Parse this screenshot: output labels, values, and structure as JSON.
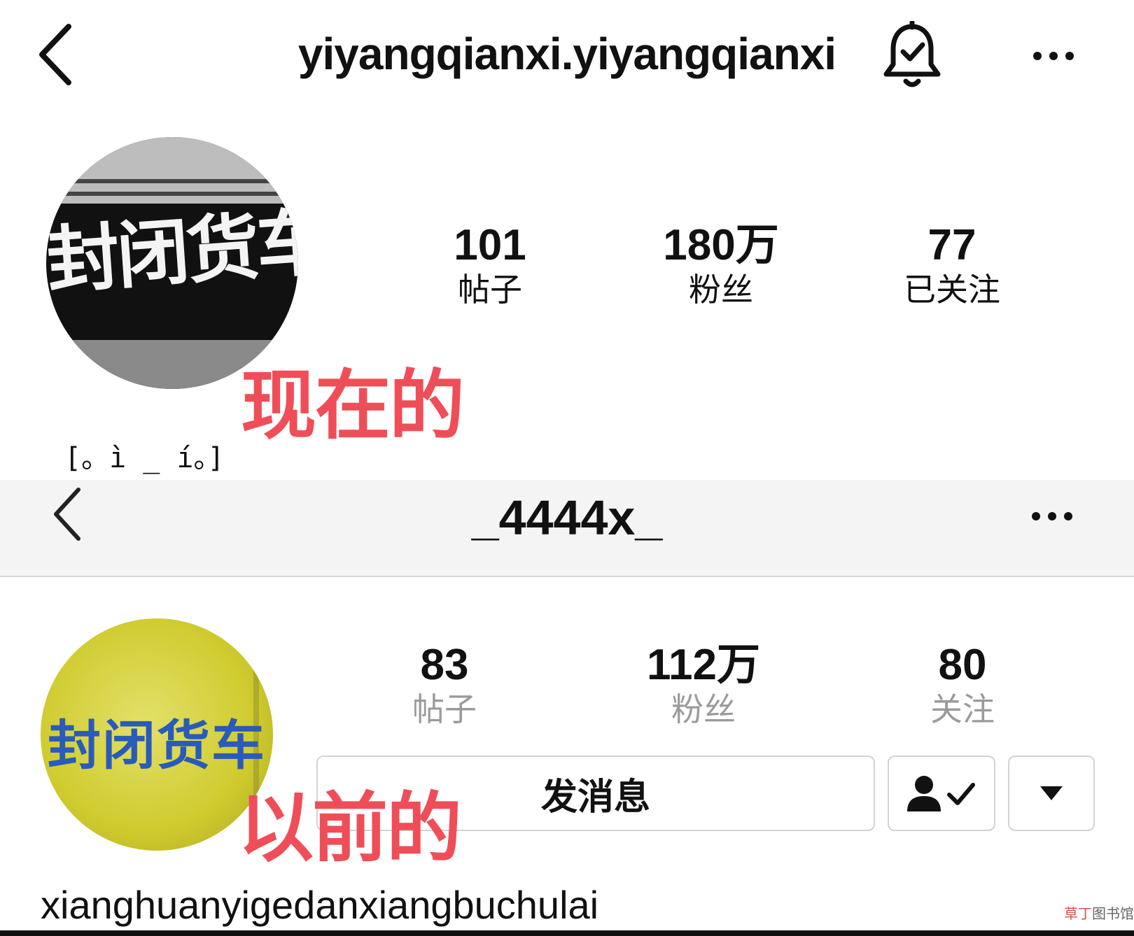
{
  "current": {
    "username": "yiyangqianxi.yiyangqianxi",
    "avatar_text": "封闭货车",
    "stats": [
      {
        "value": "101",
        "label": "帖子"
      },
      {
        "value": "180万",
        "label": "粉丝"
      },
      {
        "value": "77",
        "label": "已关注"
      }
    ],
    "caption": "现在的",
    "bio": "[。ì _ í。]"
  },
  "previous": {
    "username": "_4444x_",
    "avatar_text": "封闭货车",
    "stats": [
      {
        "value": "83",
        "label": "帖子"
      },
      {
        "value": "112万",
        "label": "粉丝"
      },
      {
        "value": "80",
        "label": "关注"
      }
    ],
    "message_button": "发消息",
    "caption": "以前的",
    "bio": "xianghuanyigedanxiangbuchulai"
  },
  "watermark": {
    "accent": "草丁",
    "rest": "图书馆"
  },
  "colors": {
    "caption": "#ef4e58",
    "avatar_previous": "#cfcb2e",
    "sign_blue": "#2a5bb8"
  },
  "icons": {
    "back": "chevron-left-icon",
    "bell": "bell-check-icon",
    "more": "more-horizontal-icon",
    "follow": "person-check-icon",
    "dropdown": "caret-down-icon"
  }
}
